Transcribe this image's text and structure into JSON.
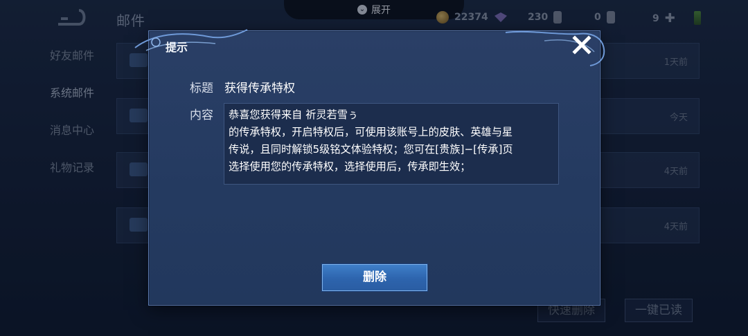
{
  "background": {
    "page_title": "邮件",
    "expand_label": "展开",
    "currencies": [
      {
        "icon": "coin-icon",
        "value": "22374"
      },
      {
        "icon": "gem-icon",
        "value": "230"
      },
      {
        "icon": "card-icon",
        "value": "0"
      },
      {
        "icon": "plus-icon",
        "value": "9"
      }
    ],
    "side_nav": [
      "好友邮件",
      "系统邮件",
      "消息中心",
      "礼物记录"
    ],
    "mail_ages": [
      "1天前",
      "今天",
      "4天前",
      "4天前"
    ],
    "bottom_buttons": {
      "quick_delete": "快速删除",
      "mark_all_read": "一键已读"
    }
  },
  "dialog": {
    "title": "提示",
    "subject_label": "标题",
    "subject_value": "获得传承特权",
    "content_label": "内容",
    "content_lines": [
      "恭喜您获得来自 祈灵若雪ぅ",
      "的传承特权，开启特权后，可使用该账号上的皮肤、英雄与星",
      "传说，且同时解锁5级铭文体验特权；您可在[贵族]−[传承]页",
      "选择使用您的传承特权，选择使用后，传承即生效；"
    ],
    "delete_button": "删除"
  }
}
